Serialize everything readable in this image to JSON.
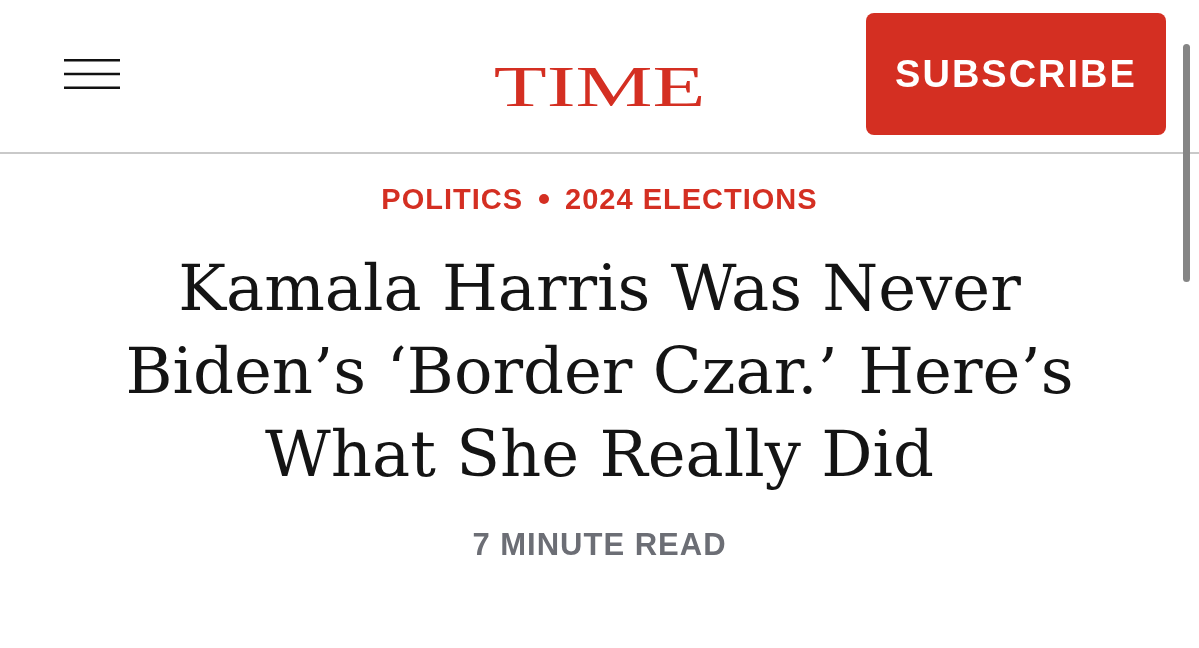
{
  "header": {
    "logo": "TIME",
    "subscribe_button": "SUBSCRIBE"
  },
  "article": {
    "categories": [
      "POLITICS",
      "2024 ELECTIONS"
    ],
    "headline": "Kamala Harris Was Never Biden’s ‘Border Czar.’ Here’s What She Really Did",
    "read_time": "7 MINUTE READ"
  }
}
